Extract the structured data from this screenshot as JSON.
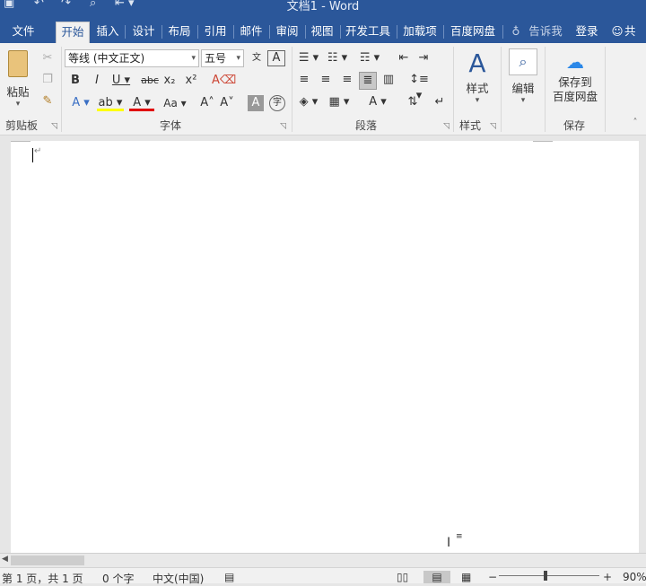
{
  "window": {
    "title": "文档1 - Word"
  },
  "tabs": [
    {
      "id": "file",
      "label": "文件"
    },
    {
      "id": "home",
      "label": "开始"
    },
    {
      "id": "insert",
      "label": "插入"
    },
    {
      "id": "design",
      "label": "设计"
    },
    {
      "id": "layout",
      "label": "布局"
    },
    {
      "id": "references",
      "label": "引用"
    },
    {
      "id": "mailings",
      "label": "邮件"
    },
    {
      "id": "review",
      "label": "审阅"
    },
    {
      "id": "view",
      "label": "视图"
    },
    {
      "id": "developer",
      "label": "开发工具"
    },
    {
      "id": "addins",
      "label": "加载项"
    },
    {
      "id": "baidu",
      "label": "百度网盘"
    }
  ],
  "tell_me": "告诉我",
  "login": "登录",
  "share": "共享",
  "ribbon": {
    "clipboard": {
      "label": "剪贴板",
      "paste": "粘贴"
    },
    "font": {
      "label": "字体",
      "font_name": "等线 (中文正文)",
      "font_size": "五号",
      "aa_label": "Aa"
    },
    "paragraph": {
      "label": "段落"
    },
    "styles": {
      "label": "样式",
      "button": "样式"
    },
    "editing": {
      "button": "编辑"
    },
    "save": {
      "label": "保存",
      "button_line1": "保存到",
      "button_line2": "百度网盘"
    }
  },
  "status": {
    "page": "第 1 页，共 1 页",
    "words": "0 个字",
    "language": "中文(中国)",
    "zoom": "90%"
  },
  "colors": {
    "brand": "#2b579a",
    "ribbon": "#f1f1f1",
    "highlight": "#ffff00",
    "font_color": "#e00000"
  }
}
